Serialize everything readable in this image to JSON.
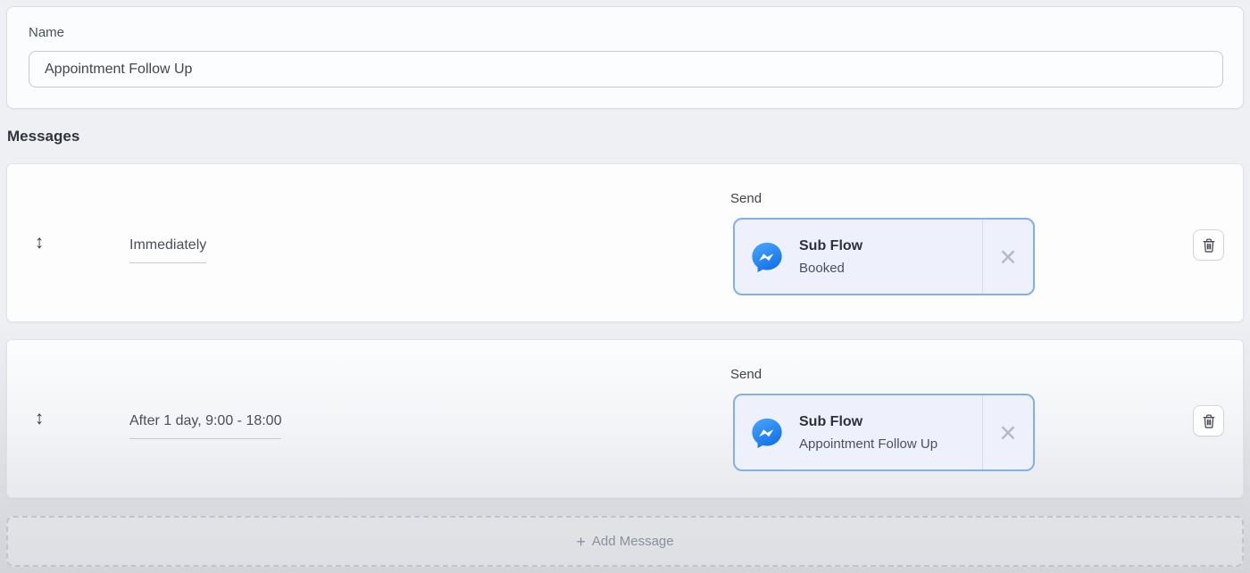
{
  "name_section": {
    "label": "Name",
    "value": "Appointment Follow Up"
  },
  "messages_section": {
    "heading": "Messages",
    "rows": [
      {
        "schedule": "Immediately",
        "send_label": "Send",
        "attachment": {
          "kind": "Sub Flow",
          "flow_name": "Booked"
        }
      },
      {
        "schedule": "After 1 day, 9:00 - 18:00",
        "send_label": "Send",
        "attachment": {
          "kind": "Sub Flow",
          "flow_name": "Appointment Follow Up"
        }
      }
    ],
    "add_message_label": "Add Message"
  },
  "icons": {
    "drag_handle": "↕",
    "close": "×",
    "plus": "+",
    "messenger": "messenger-icon",
    "trash": "trash-icon"
  },
  "colors": {
    "page_bg": "#eef0f4",
    "chip_bg": "#eef1fb",
    "chip_border": "#82b0eb",
    "messenger_blue": "#1a77f2",
    "text_dark": "#2e313a",
    "text_muted": "#8b90a0"
  }
}
